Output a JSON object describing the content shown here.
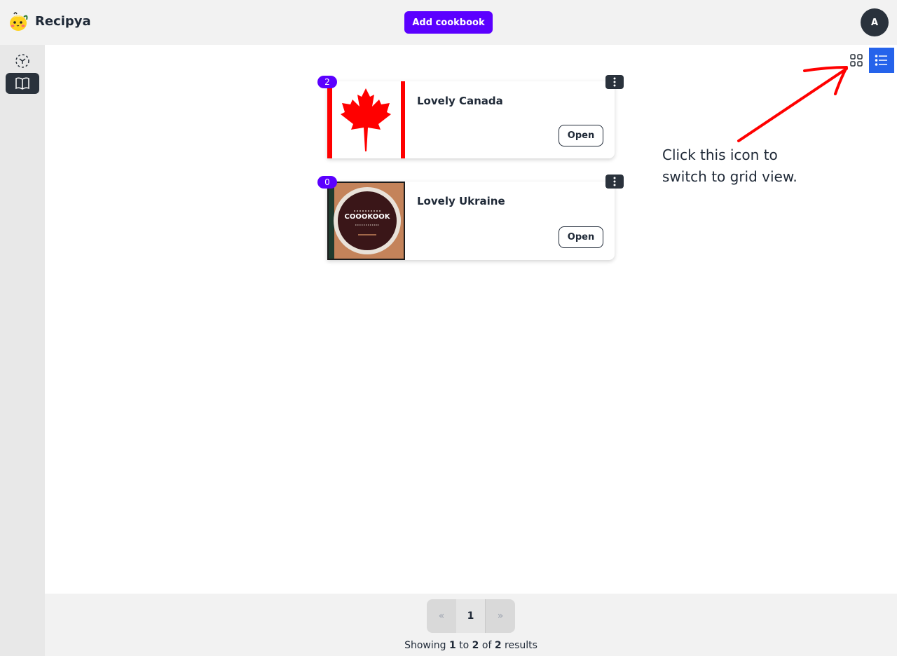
{
  "header": {
    "brand_name": "Recipya",
    "add_button_label": "Add cookbook",
    "avatar_initial": "A"
  },
  "sidebar": {
    "items": [
      {
        "icon": "scan-icon",
        "active": false
      },
      {
        "icon": "book-open-icon",
        "active": true
      }
    ]
  },
  "view_toggle": {
    "grid_icon": "grid-icon",
    "list_icon": "list-icon",
    "active": "list",
    "active_color": "#2563eb"
  },
  "cookbooks": [
    {
      "title": "Lovely Canada",
      "count": "2",
      "open_label": "Open",
      "image": "canada-flag"
    },
    {
      "title": "Lovely Ukraine",
      "count": "0",
      "open_label": "Open",
      "image": "cookbook-cover",
      "image_text": "COOOKOOK"
    }
  ],
  "annotation": {
    "text": "Click this icon to\nswitch to grid view.",
    "arrow_color": "#ff0000"
  },
  "pagination": {
    "prev_label": "«",
    "current_page": "1",
    "next_label": "»",
    "summary_prefix": "Showing",
    "from": "1",
    "to_word": "to",
    "to": "2",
    "of_word": "of",
    "total": "2",
    "summary_suffix": "results"
  },
  "colors": {
    "accent": "#5b00ff",
    "dark": "#2a323c"
  }
}
